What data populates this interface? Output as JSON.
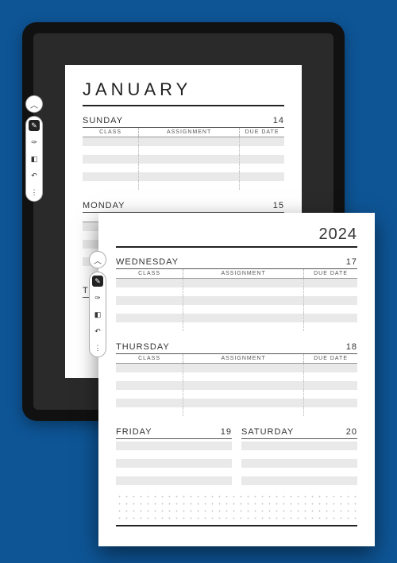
{
  "back_page": {
    "month_title": "JANUARY",
    "days": [
      {
        "name": "SUNDAY",
        "date": "14"
      },
      {
        "name": "MONDAY",
        "date": "15"
      },
      {
        "name": "TUE",
        "date": ""
      }
    ],
    "columns": {
      "c1": "CLASS",
      "c2": "ASSIGNMENT",
      "c3": "DUE DATE"
    }
  },
  "front_page": {
    "year": "2024",
    "columns": {
      "c1": "CLASS",
      "c2": "ASSIGNMENT",
      "c3": "DUE DATE"
    },
    "days_full": [
      {
        "name": "WEDNESDAY",
        "date": "17"
      },
      {
        "name": "THURSDAY",
        "date": "18"
      }
    ],
    "days_half": [
      {
        "name": "FRIDAY",
        "date": "19"
      },
      {
        "name": "SATURDAY",
        "date": "20"
      }
    ]
  },
  "toolbar": {
    "collapse": "︿",
    "tools": [
      {
        "name": "pen",
        "glyph": "✎",
        "active": true
      },
      {
        "name": "brush",
        "glyph": "✑",
        "active": false
      },
      {
        "name": "eraser",
        "glyph": "◧",
        "active": false
      },
      {
        "name": "undo",
        "glyph": "↶",
        "active": false
      },
      {
        "name": "more",
        "glyph": "⋮",
        "active": false
      }
    ]
  }
}
